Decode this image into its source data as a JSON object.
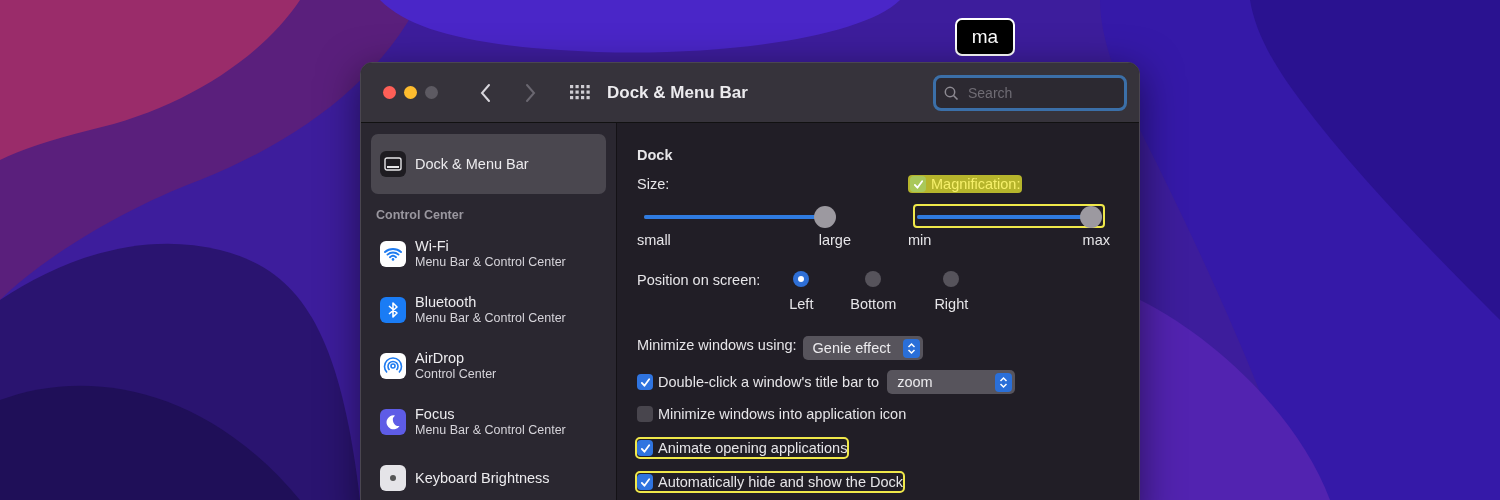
{
  "key_overlay": {
    "text": "ma"
  },
  "window": {
    "title": "Dock & Menu Bar",
    "nav": {
      "back_enabled": true,
      "forward_enabled": false
    },
    "search": {
      "placeholder": "Search",
      "focused": true
    }
  },
  "sidebar": {
    "items": [
      {
        "label": "Dock & Menu Bar",
        "selected": true
      }
    ],
    "section": "Control Center",
    "section_items": [
      {
        "label": "Wi-Fi",
        "detail": "Menu Bar & Control Center",
        "selected": false
      },
      {
        "label": "Bluetooth",
        "detail": "Menu Bar & Control Center",
        "selected": false
      },
      {
        "label": "AirDrop",
        "detail": "Control Center",
        "selected": false
      },
      {
        "label": "Focus",
        "detail": "Menu Bar & Control Center",
        "selected": false
      },
      {
        "label": "Keyboard Brightness",
        "selected": false
      }
    ]
  },
  "content": {
    "section_title": "Dock",
    "size": {
      "label": "Size:",
      "level": 0.95,
      "min_label": "small",
      "max_label": "large"
    },
    "magnification": {
      "label": "Magnification:",
      "checked": true,
      "highlighted": true,
      "level": 1,
      "slider_highlighted": true,
      "min_label": "min",
      "max_label": "max"
    },
    "position": {
      "label": "Position on screen:",
      "options": [
        {
          "label": "Left",
          "selected": true
        },
        {
          "label": "Bottom",
          "selected": false
        },
        {
          "label": "Right",
          "selected": false
        }
      ]
    },
    "minimize_effect": {
      "label": "Minimize windows using:",
      "value": "Genie effect"
    },
    "options": [
      {
        "kind": "select",
        "label": "Double-click a window's title bar to",
        "checked": true,
        "highlighted": false,
        "value": "zoom"
      },
      {
        "kind": "plain",
        "label": "Minimize windows into application icon",
        "checked": false,
        "highlighted": false
      },
      {
        "kind": "plain",
        "label": "Animate opening applications",
        "checked": true,
        "highlighted": true
      },
      {
        "kind": "plain",
        "label": "Automatically hide and show the Dock",
        "checked": true,
        "highlighted": true
      }
    ]
  }
}
